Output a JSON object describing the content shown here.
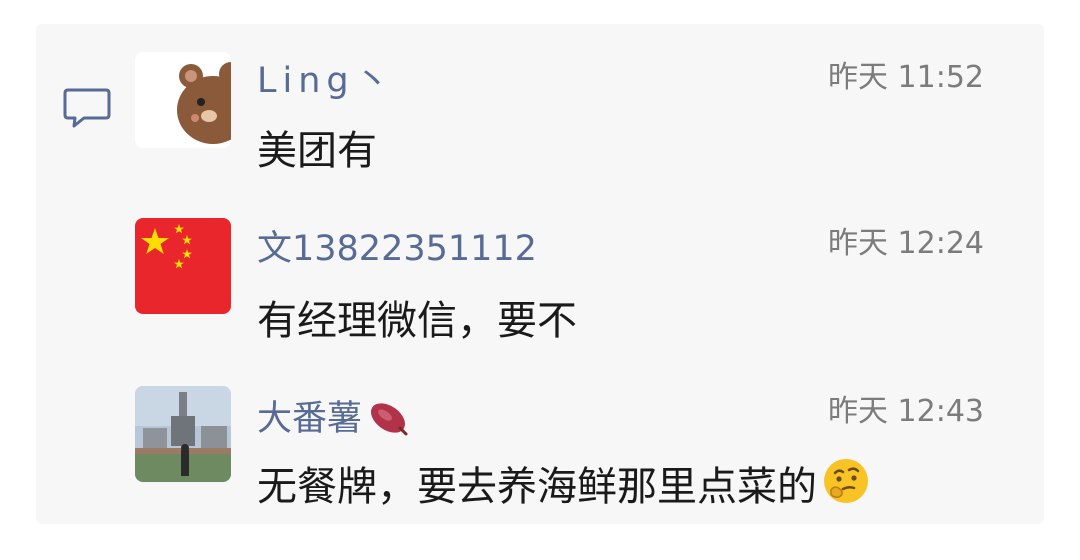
{
  "comments": [
    {
      "name": "Ling丶",
      "time": "昨天 11:52",
      "text": "美团有",
      "avatar": "bear-avatar"
    },
    {
      "name": "文13822351112",
      "time": "昨天 12:24",
      "text": "有经理微信，要不",
      "avatar": "china-flag-avatar"
    },
    {
      "name": "大番薯",
      "name_emoji": "sweet-potato-icon",
      "time": "昨天 12:43",
      "text": "无餐牌，要去养海鲜那里点菜的",
      "text_emoji": "thinking-face-icon",
      "avatar": "photo-avatar"
    }
  ],
  "colors": {
    "name": "#576b95",
    "time": "#7c7c7c",
    "text": "#1a1a1a",
    "panel": "#f7f7f7"
  },
  "icons": {
    "comment": "comment-bubble-icon"
  }
}
